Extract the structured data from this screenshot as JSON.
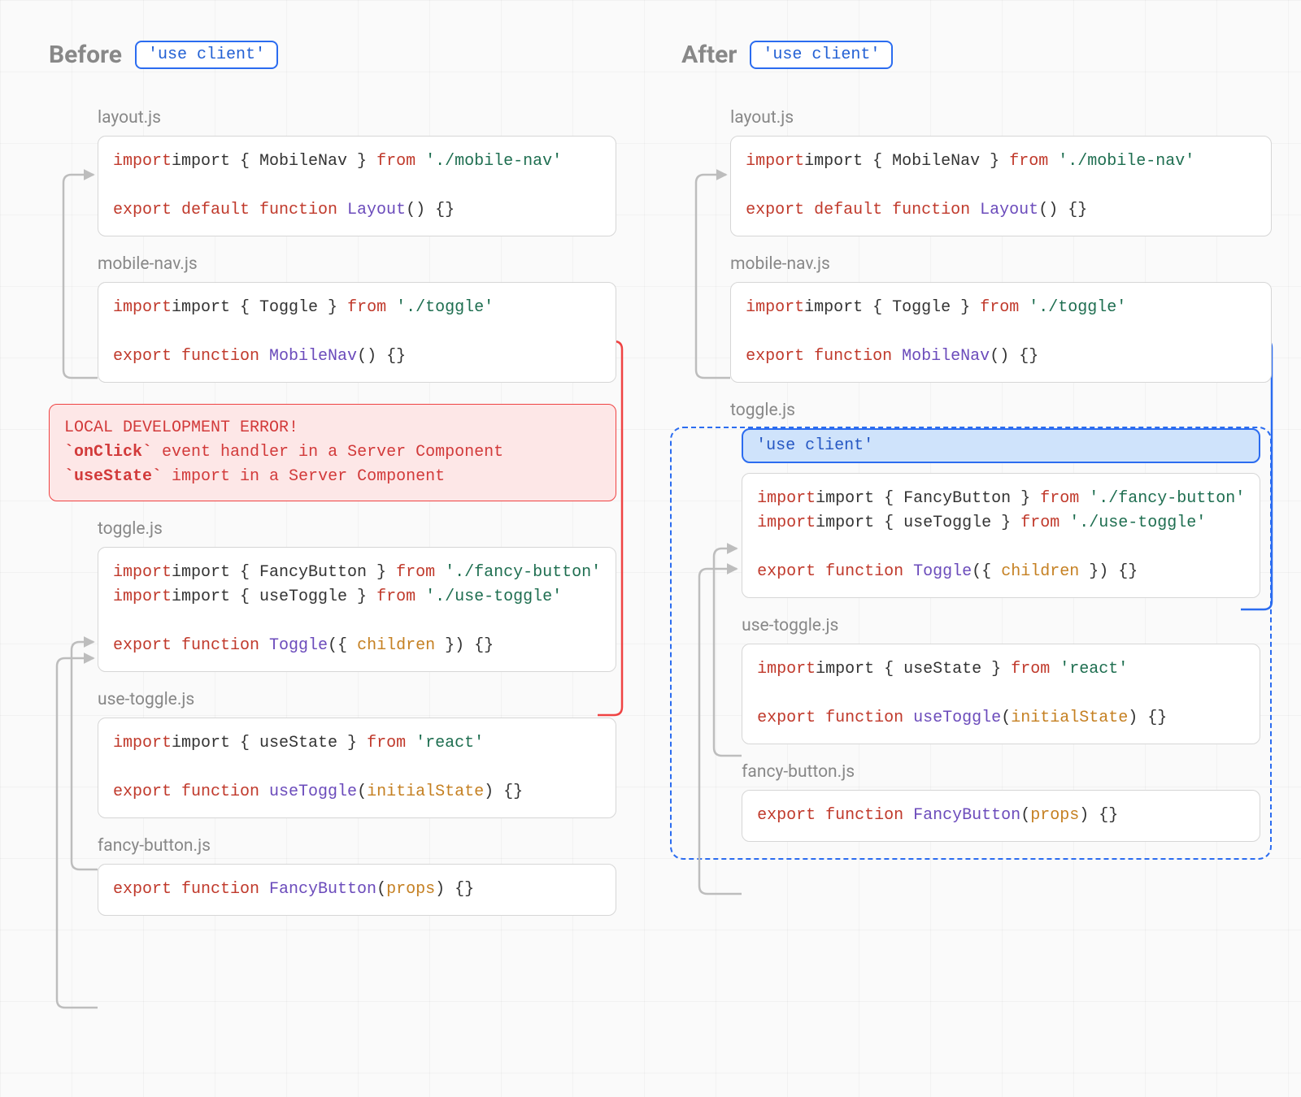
{
  "before": {
    "title": "Before",
    "badge": "'use client'",
    "files": {
      "layout": {
        "label": "layout.js",
        "line1_pre": "import { MobileNav } ",
        "line1_from": "from",
        "line1_path": " './mobile-nav'",
        "line2_export": "export default function",
        "line2_fn": " Layout",
        "line2_rest": "() {}"
      },
      "mobileNav": {
        "label": "mobile-nav.js",
        "line1_pre": "import { Toggle } ",
        "line1_from": "from",
        "line1_path": " './toggle'",
        "line2_export": "export function",
        "line2_fn": " MobileNav",
        "line2_rest": "() {}"
      },
      "toggle": {
        "label": "toggle.js",
        "line1_pre": "import { FancyButton } ",
        "line1_from": "from",
        "line1_path": " './fancy-button'",
        "line2_pre": "import { useToggle } ",
        "line2_from": "from",
        "line2_path": " './use-toggle'",
        "line3_export": "export function",
        "line3_fn": " Toggle",
        "line3_open": "({ ",
        "line3_param": "children",
        "line3_close": " }) {}"
      },
      "useToggle": {
        "label": "use-toggle.js",
        "line1_pre": "import { useState } ",
        "line1_from": "from",
        "line1_path": " 'react'",
        "line2_export": "export function",
        "line2_fn": " useToggle",
        "line2_open": "(",
        "line2_param": "initialState",
        "line2_close": ") {}"
      },
      "fancyButton": {
        "label": "fancy-button.js",
        "line1_export": "export function",
        "line1_fn": " FancyButton",
        "line1_open": "(",
        "line1_param": "props",
        "line1_close": ") {}"
      }
    },
    "error": {
      "title": "LOCAL DEVELOPMENT ERROR!",
      "line1_b": "`onClick`",
      "line1_rest": " event handler in a Server Component",
      "line2_b": "`useState`",
      "line2_rest": " import in a Server Component"
    }
  },
  "after": {
    "title": "After",
    "badge": "'use client'",
    "files": {
      "layout": {
        "label": "layout.js",
        "line1_pre": "import { MobileNav } ",
        "line1_from": "from",
        "line1_path": " './mobile-nav'",
        "line2_export": "export default function",
        "line2_fn": " Layout",
        "line2_rest": "() {}"
      },
      "mobileNav": {
        "label": "mobile-nav.js",
        "line1_pre": "import { Toggle } ",
        "line1_from": "from",
        "line1_path": " './toggle'",
        "line2_export": "export function",
        "line2_fn": " MobileNav",
        "line2_rest": "() {}"
      },
      "toggle": {
        "label": "toggle.js",
        "useClient": "'use client'",
        "line1_pre": "import { FancyButton } ",
        "line1_from": "from",
        "line1_path": " './fancy-button'",
        "line2_pre": "import { useToggle } ",
        "line2_from": "from",
        "line2_path": " './use-toggle'",
        "line3_export": "export function",
        "line3_fn": " Toggle",
        "line3_open": "({ ",
        "line3_param": "children",
        "line3_close": " }) {}"
      },
      "useToggle": {
        "label": "use-toggle.js",
        "line1_pre": "import { useState } ",
        "line1_from": "from",
        "line1_path": " 'react'",
        "line2_export": "export function",
        "line2_fn": " useToggle",
        "line2_open": "(",
        "line2_param": "initialState",
        "line2_close": ") {}"
      },
      "fancyButton": {
        "label": "fancy-button.js",
        "line1_export": "export function",
        "line1_fn": " FancyButton",
        "line1_open": "(",
        "line1_param": "props",
        "line1_close": ") {}"
      }
    }
  }
}
